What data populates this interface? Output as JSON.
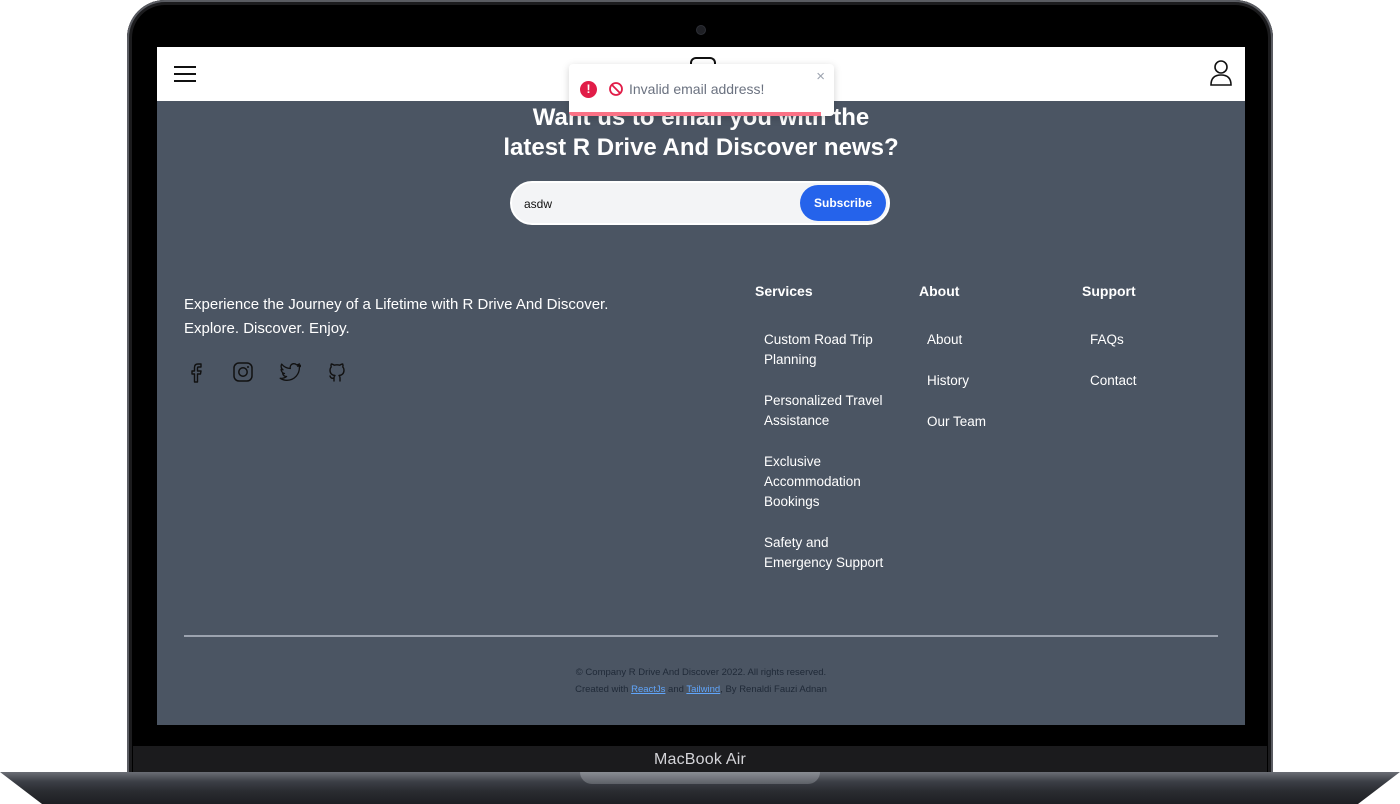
{
  "device": {
    "label": "MacBook Air"
  },
  "navbar": {},
  "newsletter": {
    "title_line1": "Want us to email you with the",
    "title_line2": "latest R Drive And Discover news?",
    "email_value": "asdw",
    "subscribe_label": "Subscribe"
  },
  "footer": {
    "tagline_line1": "Experience the Journey of a Lifetime with R Drive And Discover.",
    "tagline_line2": "Explore. Discover. Enjoy.",
    "socials": [
      "facebook-icon",
      "instagram-icon",
      "twitter-icon",
      "github-icon"
    ],
    "services": {
      "heading": "Services",
      "links": [
        "Custom Road Trip Planning",
        "Personalized Travel Assistance",
        "Exclusive Accommodation Bookings",
        "Safety and Emergency Support"
      ]
    },
    "about": {
      "heading": "About",
      "links": [
        "About",
        "History",
        "Our Team"
      ]
    },
    "support": {
      "heading": "Support",
      "links": [
        "FAQs",
        "Contact"
      ]
    },
    "copyright": "© Company R Drive And Discover 2022. All rights reserved.",
    "credits_prefix": "Created with ",
    "credits_react": "ReactJs",
    "credits_and": " and ",
    "credits_tailwind": "Tailwind",
    "credits_suffix": ", By Renaldi Fauzi Adnan"
  },
  "toast": {
    "message": "Invalid email address!",
    "alert_glyph": "!",
    "close_glyph": "×",
    "progress_fraction": 0.95
  },
  "colors": {
    "footer_bg": "#4b5563",
    "accent": "#2563eb",
    "toast_progress": "#fb7185",
    "error": "#e11d48"
  }
}
